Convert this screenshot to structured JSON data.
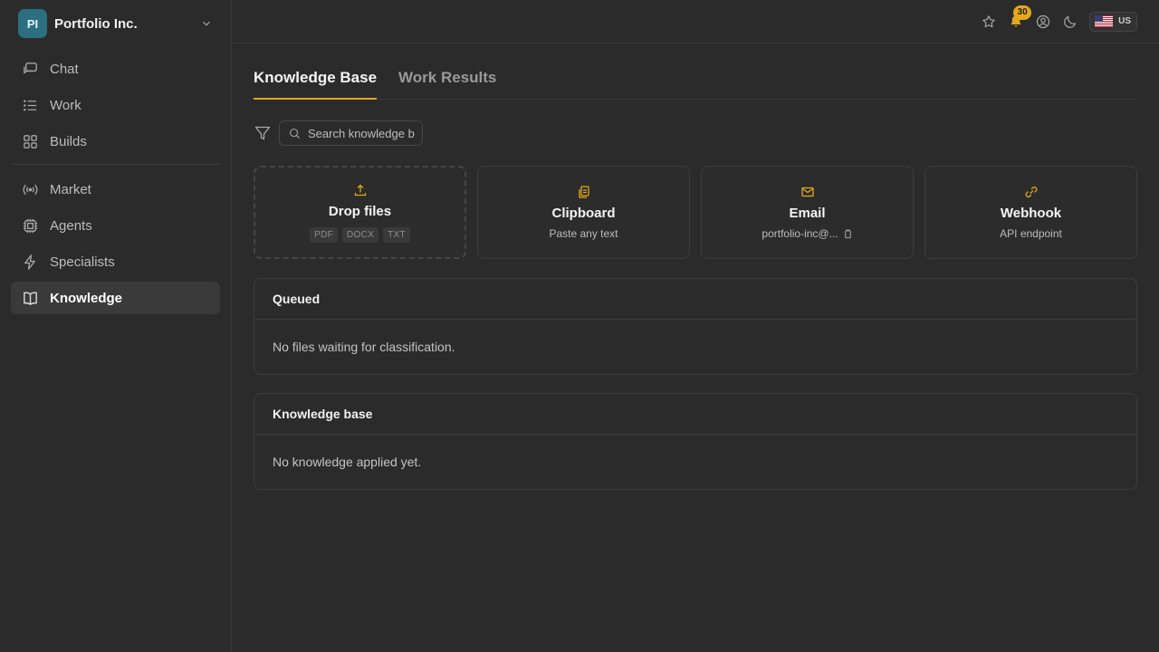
{
  "org": {
    "initials": "PI",
    "name": "Portfolio Inc."
  },
  "nav": {
    "primary": [
      {
        "label": "Chat",
        "icon": "chat-icon"
      },
      {
        "label": "Work",
        "icon": "list-icon"
      },
      {
        "label": "Builds",
        "icon": "grid-icon"
      }
    ],
    "secondary": [
      {
        "label": "Market",
        "icon": "broadcast-icon"
      },
      {
        "label": "Agents",
        "icon": "chip-icon"
      },
      {
        "label": "Specialists",
        "icon": "lightning-icon"
      },
      {
        "label": "Knowledge",
        "icon": "book-icon",
        "active": true
      }
    ]
  },
  "topbar": {
    "notification_count": "30",
    "locale": "US",
    "icons": [
      "star-icon",
      "bell-icon",
      "user-circle-icon",
      "moon-icon",
      "us-flag-icon"
    ]
  },
  "tabs": [
    {
      "label": "Knowledge Base",
      "active": true
    },
    {
      "label": "Work Results",
      "active": false
    }
  ],
  "search": {
    "placeholder": "Search knowledge base"
  },
  "cards": {
    "drop": {
      "title": "Drop files",
      "formats": [
        "PDF",
        "DOCX",
        "TXT"
      ]
    },
    "clipboard": {
      "title": "Clipboard",
      "subtitle": "Paste any text"
    },
    "email": {
      "title": "Email",
      "subtitle": "portfolio-inc@..."
    },
    "webhook": {
      "title": "Webhook",
      "subtitle": "API endpoint"
    }
  },
  "panels": {
    "queued": {
      "title": "Queued",
      "empty": "No files waiting for classification."
    },
    "knowledge": {
      "title": "Knowledge base",
      "empty": "No knowledge applied yet."
    }
  },
  "colors": {
    "accent": "#e6a817",
    "avatar": "#2b6f80",
    "background": "#2b2b2b"
  }
}
